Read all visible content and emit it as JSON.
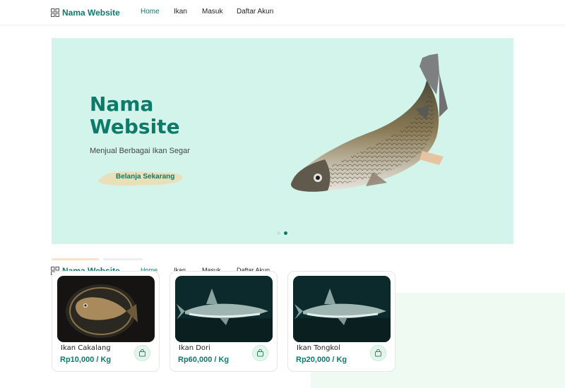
{
  "brand": {
    "name": "Nama Website"
  },
  "nav": {
    "home": "Home",
    "ikan": "Ikan",
    "masuk": "Masuk",
    "daftar": "Daftar Akun"
  },
  "hero": {
    "title": "Nama Website",
    "subtitle": "Menjual Berbagai Ikan Segar",
    "cta": "Belanja Sekarang",
    "slides_total": 2,
    "active_slide": 2
  },
  "products": [
    {
      "name": "Ikan Cakalang",
      "price": "Rp10,000 / Kg"
    },
    {
      "name": "Ikan Dori",
      "price": "Rp60,000 / Kg"
    },
    {
      "name": "Ikan Tongkol",
      "price": "Rp20,000 / Kg"
    }
  ],
  "colors": {
    "accent": "#0e7a6a",
    "hero_bg": "#d2f4ea",
    "cta_brush": "#e9dfb8",
    "tab_active": "#fde2c4",
    "tab_inactive": "#eeeeee"
  },
  "icons": {
    "brand": "grid-icon",
    "cart": "shopping-bag-icon"
  }
}
